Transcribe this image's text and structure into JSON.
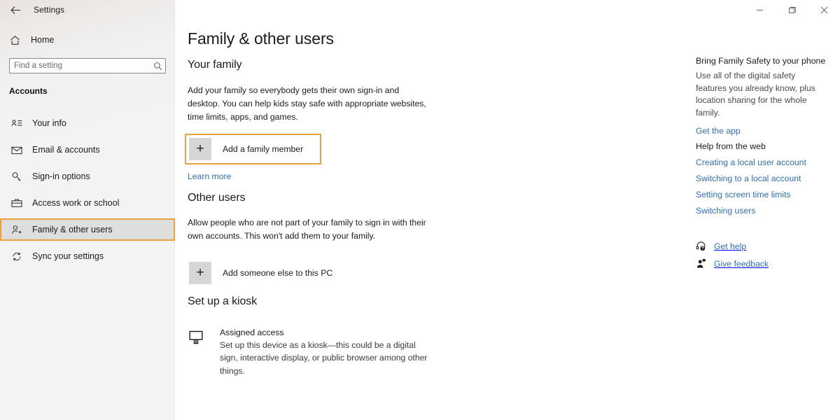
{
  "window": {
    "title": "Settings",
    "back_icon": "back-arrow-icon",
    "minimize_label": "—",
    "maximize_label": "❐",
    "close_label": "✕"
  },
  "sidebar": {
    "home_label": "Home",
    "home_icon": "home-icon",
    "search": {
      "placeholder": "Find a setting",
      "value": "",
      "icon": "search-icon"
    },
    "section_label": "Accounts",
    "items": [
      {
        "label": "Your info",
        "icon": "contact-card-icon",
        "selected": false
      },
      {
        "label": "Email & accounts",
        "icon": "envelope-icon",
        "selected": false
      },
      {
        "label": "Sign-in options",
        "icon": "key-icon",
        "selected": false
      },
      {
        "label": "Access work or school",
        "icon": "briefcase-icon",
        "selected": false
      },
      {
        "label": "Family & other users",
        "icon": "person-add-icon",
        "selected": true
      },
      {
        "label": "Sync your settings",
        "icon": "sync-icon",
        "selected": false
      }
    ]
  },
  "main": {
    "page_title": "Family & other users",
    "family": {
      "heading": "Your family",
      "description": "Add your family so everybody gets their own sign-in and desktop. You can help kids stay safe with appropriate websites, time limits, apps, and games.",
      "add_button_label": "Add a family member",
      "add_button_icon": "plus-icon",
      "learn_more_label": "Learn more"
    },
    "other_users": {
      "heading": "Other users",
      "description": "Allow people who are not part of your family to sign in with their own accounts. This won't add them to your family.",
      "add_button_label": "Add someone else to this PC",
      "add_button_icon": "plus-icon"
    },
    "kiosk": {
      "heading": "Set up a kiosk",
      "item_icon": "kiosk-display-icon",
      "item_title": "Assigned access",
      "item_description": "Set up this device as a kiosk—this could be a digital sign, interactive display, or public browser among other things."
    }
  },
  "rail": {
    "promo": {
      "heading": "Bring Family Safety to your phone",
      "body": "Use all of the digital safety features you already know, plus location sharing for the whole family.",
      "link": "Get the app"
    },
    "help_web": {
      "heading": "Help from the web",
      "links": [
        "Creating a local user account",
        "Switching to a local account",
        "Setting screen time limits",
        "Switching users"
      ]
    },
    "support": [
      {
        "label": "Get help",
        "icon": "headset-help-icon"
      },
      {
        "label": "Give feedback",
        "icon": "feedback-person-icon"
      }
    ]
  },
  "colors": {
    "highlight": "#e8a33d",
    "link": "#2f6fbb",
    "selected_bg": "#dedede",
    "sidebar_bg": "#f3f3f3"
  }
}
